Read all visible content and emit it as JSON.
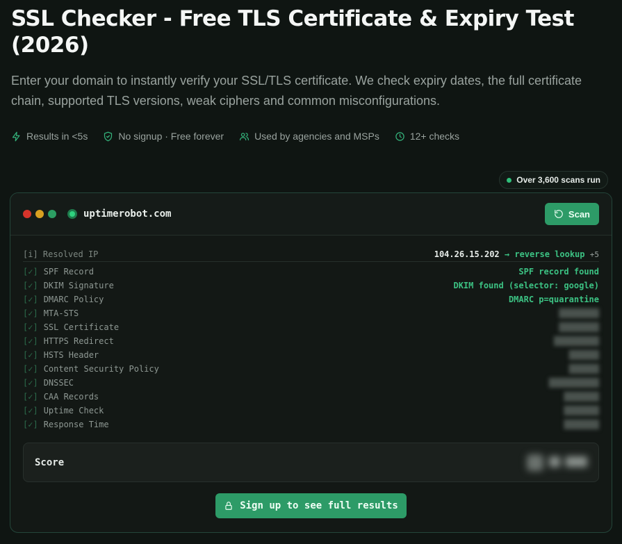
{
  "page": {
    "title": "SSL Checker - Free TLS Certificate & Expiry Test (2026)",
    "subtitle": "Enter your domain to instantly verify your SSL/TLS certificate. We check expiry dates, the full certificate chain, supported TLS versions, weak ciphers and common misconfigurations."
  },
  "features": [
    {
      "icon": "lightning-icon",
      "label": "Results in <5s"
    },
    {
      "icon": "shield-check-icon",
      "label": "No signup · Free forever"
    },
    {
      "icon": "users-icon",
      "label": "Used by agencies and MSPs"
    },
    {
      "icon": "clock-icon",
      "label": "12+ checks"
    }
  ],
  "badge": {
    "label": "Over 3,600 scans run"
  },
  "terminal": {
    "domain": "uptimerobot.com",
    "scan_label": "Scan",
    "resolved": {
      "prefix": "[i]",
      "label": "Resolved IP",
      "ip": "104.26.15.202",
      "arrow": "→",
      "lookup": "reverse lookup",
      "extra": "+5"
    },
    "checks": [
      {
        "mark": "[✓]",
        "label": "SPF Record",
        "result": "SPF record found"
      },
      {
        "mark": "[✓]",
        "label": "DKIM Signature",
        "result": "DKIM found (selector: google)"
      },
      {
        "mark": "[✓]",
        "label": "DMARC Policy",
        "result": "DMARC p=quarantine"
      },
      {
        "mark": "[✓]",
        "label": "MTA-STS",
        "result": ""
      },
      {
        "mark": "[✓]",
        "label": "SSL Certificate",
        "result": ""
      },
      {
        "mark": "[✓]",
        "label": "HTTPS Redirect",
        "result": ""
      },
      {
        "mark": "[✓]",
        "label": "HSTS Header",
        "result": ""
      },
      {
        "mark": "[✓]",
        "label": "Content Security Policy",
        "result": ""
      },
      {
        "mark": "[✓]",
        "label": "DNSSEC",
        "result": ""
      },
      {
        "mark": "[✓]",
        "label": "CAA Records",
        "result": ""
      },
      {
        "mark": "[✓]",
        "label": "Uptime Check",
        "result": ""
      },
      {
        "mark": "[✓]",
        "label": "Response Time",
        "result": ""
      }
    ],
    "score_label": "Score",
    "signup_label": "Sign up to see full results"
  },
  "colors": {
    "accent": "#2d9b67",
    "accent_text": "#3cc283",
    "background": "#0f1512"
  }
}
